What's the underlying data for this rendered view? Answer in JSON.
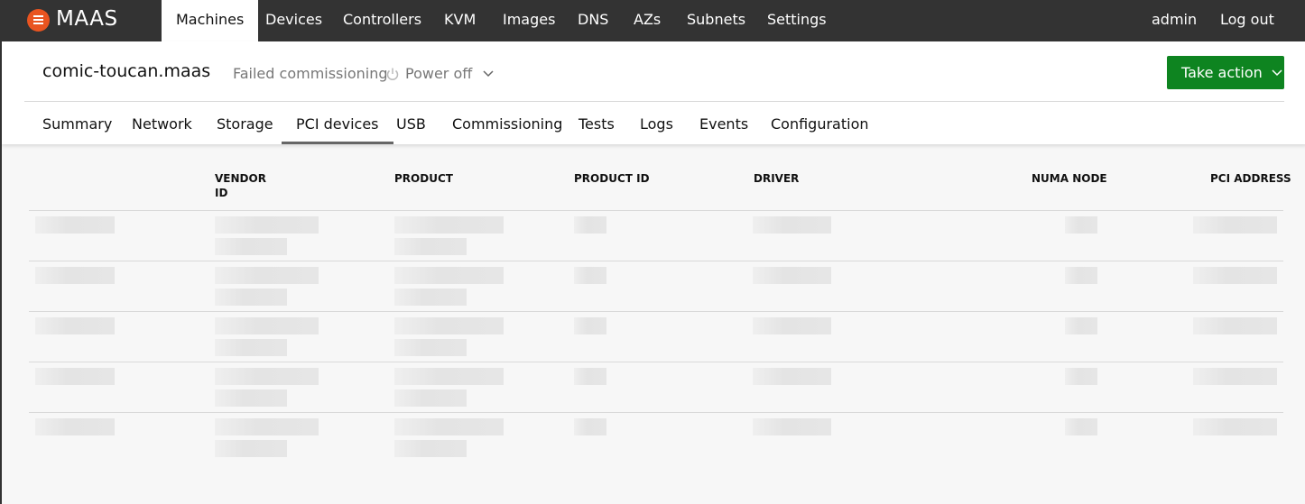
{
  "nav": {
    "brand": "MAAS",
    "items": [
      "Machines",
      "Devices",
      "Controllers",
      "KVM",
      "Images",
      "DNS",
      "AZs",
      "Subnets",
      "Settings"
    ],
    "active": "Machines",
    "user": "admin",
    "logout": "Log out"
  },
  "machine": {
    "name": "comic-toucan.maas",
    "status": "Failed commissioning",
    "power": "Power off",
    "take_action": "Take action"
  },
  "tabs": [
    "Summary",
    "Network",
    "Storage",
    "PCI devices",
    "USB",
    "Commissioning",
    "Tests",
    "Logs",
    "Events",
    "Configuration"
  ],
  "active_tab": "PCI devices",
  "table": {
    "headers": [
      "VENDOR\nID",
      "PRODUCT",
      "PRODUCT ID",
      "DRIVER",
      "NUMA NODE",
      "PCI ADDRESS"
    ],
    "loading_rows": 5
  },
  "colors": {
    "nav": "#333333",
    "brand": "#e95420",
    "action": "#0e8420"
  }
}
